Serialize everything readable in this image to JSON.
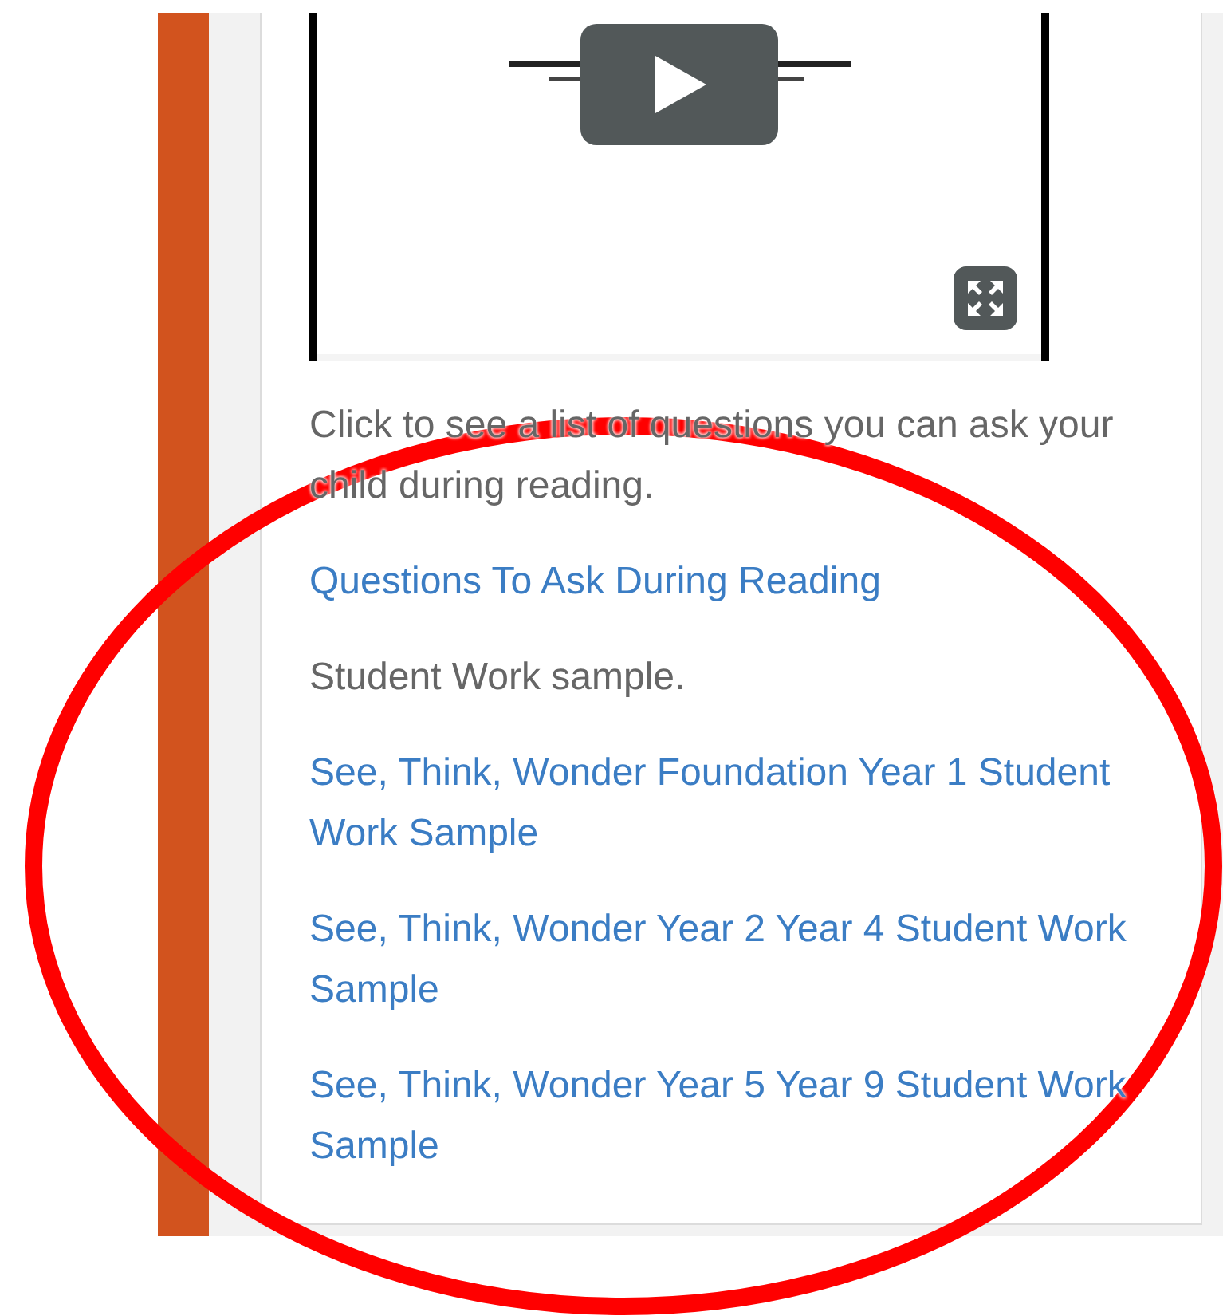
{
  "content": [
    {
      "kind": "text",
      "text": "Click to see a list of questions you can ask your child during reading."
    },
    {
      "kind": "link",
      "text": "Questions To Ask During Reading"
    },
    {
      "kind": "text",
      "text": "Student Work sample."
    },
    {
      "kind": "link",
      "text": "See, Think, Wonder Foundation Year 1 Student Work Sample"
    },
    {
      "kind": "link",
      "text": "See, Think, Wonder Year 2 Year 4 Student Work Sample"
    },
    {
      "kind": "link",
      "text": "See, Think, Wonder Year 5 Year 9 Student Work Sample"
    }
  ],
  "annotations": [
    {
      "kind": "ellipse"
    }
  ]
}
